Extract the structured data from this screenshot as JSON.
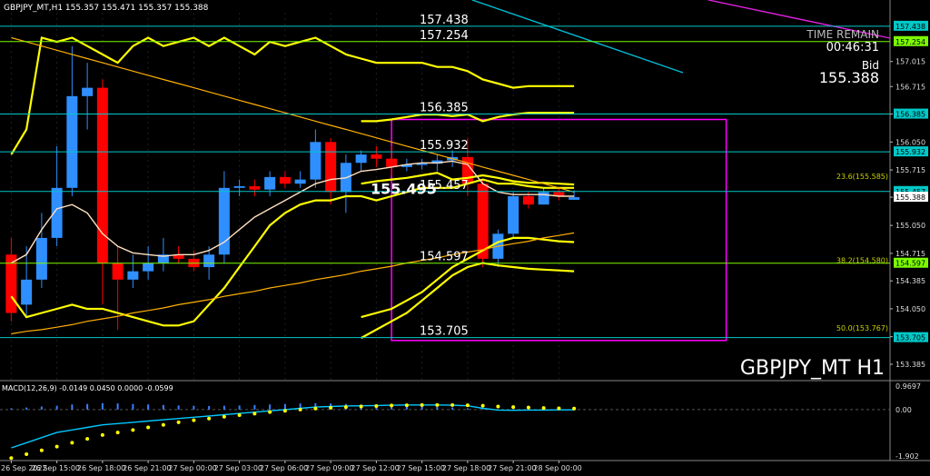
{
  "chart_data": {
    "type": "candlestick",
    "header": "GBPJPY_MT,H1  155.357 155.471 155.357 155.388",
    "symbol_label": "GBPJPY_MT H1",
    "time_remain": {
      "label": "TIME REMAIN",
      "value": "00:46:31"
    },
    "bid": {
      "label": "Bid",
      "value": "155.388"
    },
    "ylim": [
      153.2,
      157.6
    ],
    "x_count": 49,
    "x_ticks": [
      {
        "i": 0,
        "label": "26 Sep 2022"
      },
      {
        "i": 3,
        "label": "26 Sep 15:00"
      },
      {
        "i": 6,
        "label": "26 Sep 18:00"
      },
      {
        "i": 9,
        "label": "26 Sep 21:00"
      },
      {
        "i": 12,
        "label": "27 Sep 00:00"
      },
      {
        "i": 15,
        "label": "27 Sep 03:00"
      },
      {
        "i": 18,
        "label": "27 Sep 06:00"
      },
      {
        "i": 21,
        "label": "27 Sep 09:00"
      },
      {
        "i": 24,
        "label": "27 Sep 12:00"
      },
      {
        "i": 27,
        "label": "27 Sep 15:00"
      },
      {
        "i": 30,
        "label": "27 Sep 18:00"
      },
      {
        "i": 33,
        "label": "27 Sep 21:00"
      },
      {
        "i": 36,
        "label": "28 Sep 00:00"
      }
    ],
    "y_ticks": [
      "157.015",
      "156.715",
      "156.385",
      "156.050",
      "155.715",
      "155.388",
      "155.050",
      "154.715",
      "154.385",
      "154.050",
      "153.715",
      "153.385"
    ],
    "price_tags": [
      {
        "value": 157.438,
        "label": "157.438",
        "color": "#00c8c8"
      },
      {
        "value": 157.254,
        "label": "157.254",
        "color": "#7cfc00"
      },
      {
        "value": 156.385,
        "label": "156.385",
        "color": "#00c8c8"
      },
      {
        "value": 155.932,
        "label": "155.932",
        "color": "#00c8c8"
      },
      {
        "value": 155.457,
        "label": "155.457",
        "color": "#00c8c8"
      },
      {
        "value": 154.597,
        "label": "154.597",
        "color": "#7cfc00"
      },
      {
        "value": 153.705,
        "label": "153.705",
        "color": "#00c8c8"
      }
    ],
    "current_price": {
      "value": 155.388,
      "label": "155.388"
    },
    "hlines": [
      {
        "value": 157.438,
        "label": "157.438",
        "color": "#00c8c8"
      },
      {
        "value": 157.254,
        "label": "157.254",
        "color": "#7cfc00"
      },
      {
        "value": 156.385,
        "label": "156.385",
        "color": "#00c8c8"
      },
      {
        "value": 155.932,
        "label": "155.932",
        "color": "#00c8c8"
      },
      {
        "value": 155.457,
        "label": "155.457",
        "color": "#00c8c8"
      },
      {
        "value": 154.597,
        "label": "154.597",
        "color": "#7cfc00"
      },
      {
        "value": 153.705,
        "label": "153.705",
        "color": "#00c8c8"
      }
    ],
    "fib_labels": [
      {
        "value": 155.585,
        "label": "23.6(155.585)"
      },
      {
        "value": 154.58,
        "label": "38.2(154.580)"
      },
      {
        "value": 153.767,
        "label": "50.0(153.767)"
      }
    ],
    "big_label": {
      "value": 155.495,
      "label": "155.495"
    },
    "box": {
      "i0": 25,
      "i1": 47,
      "y_top": 156.32,
      "y_bottom": 153.67
    },
    "candles": [
      {
        "o": 154.7,
        "h": 154.9,
        "c": 154.0,
        "l": 153.9
      },
      {
        "o": 154.1,
        "h": 154.8,
        "c": 154.4,
        "l": 153.95
      },
      {
        "o": 154.4,
        "h": 155.2,
        "c": 154.9,
        "l": 154.3
      },
      {
        "o": 154.9,
        "h": 156.0,
        "c": 155.5,
        "l": 154.8
      },
      {
        "o": 155.5,
        "h": 157.2,
        "c": 156.6,
        "l": 155.4
      },
      {
        "o": 156.6,
        "h": 157.0,
        "c": 156.7,
        "l": 156.2
      },
      {
        "o": 156.7,
        "h": 156.8,
        "c": 154.6,
        "l": 154.1
      },
      {
        "o": 154.6,
        "h": 154.8,
        "c": 154.4,
        "l": 153.8
      },
      {
        "o": 154.4,
        "h": 154.7,
        "c": 154.5,
        "l": 154.3
      },
      {
        "o": 154.5,
        "h": 154.8,
        "c": 154.6,
        "l": 154.4
      },
      {
        "o": 154.6,
        "h": 154.9,
        "c": 154.7,
        "l": 154.5
      },
      {
        "o": 154.7,
        "h": 154.8,
        "c": 154.65,
        "l": 154.6
      },
      {
        "o": 154.65,
        "h": 154.75,
        "c": 154.55,
        "l": 154.5
      },
      {
        "o": 154.55,
        "h": 154.8,
        "c": 154.7,
        "l": 154.4
      },
      {
        "o": 154.7,
        "h": 155.7,
        "c": 155.5,
        "l": 154.6
      },
      {
        "o": 155.5,
        "h": 155.6,
        "c": 155.52,
        "l": 155.4
      },
      {
        "o": 155.52,
        "h": 155.6,
        "c": 155.48,
        "l": 155.4
      },
      {
        "o": 155.48,
        "h": 155.7,
        "c": 155.63,
        "l": 155.4
      },
      {
        "o": 155.63,
        "h": 155.7,
        "c": 155.55,
        "l": 155.5
      },
      {
        "o": 155.55,
        "h": 155.7,
        "c": 155.6,
        "l": 155.5
      },
      {
        "o": 155.6,
        "h": 156.2,
        "c": 156.05,
        "l": 155.5
      },
      {
        "o": 156.05,
        "h": 156.1,
        "c": 155.45,
        "l": 155.3
      },
      {
        "o": 155.45,
        "h": 155.9,
        "c": 155.8,
        "l": 155.2
      },
      {
        "o": 155.8,
        "h": 155.95,
        "c": 155.9,
        "l": 155.7
      },
      {
        "o": 155.9,
        "h": 156.0,
        "c": 155.85,
        "l": 155.75
      },
      {
        "o": 155.85,
        "h": 156.0,
        "c": 155.75,
        "l": 155.65
      },
      {
        "o": 155.75,
        "h": 155.85,
        "c": 155.78,
        "l": 155.7
      },
      {
        "o": 155.78,
        "h": 155.85,
        "c": 155.79,
        "l": 155.72
      },
      {
        "o": 155.79,
        "h": 155.9,
        "c": 155.83,
        "l": 155.7
      },
      {
        "o": 155.83,
        "h": 155.95,
        "c": 155.87,
        "l": 155.75
      },
      {
        "o": 155.87,
        "h": 156.1,
        "c": 155.55,
        "l": 155.4
      },
      {
        "o": 155.55,
        "h": 155.6,
        "c": 154.65,
        "l": 154.55
      },
      {
        "o": 154.65,
        "h": 155.0,
        "c": 154.95,
        "l": 154.55
      },
      {
        "o": 154.95,
        "h": 155.45,
        "c": 155.4,
        "l": 154.9
      },
      {
        "o": 155.4,
        "h": 155.45,
        "c": 155.3,
        "l": 155.25
      },
      {
        "o": 155.3,
        "h": 155.5,
        "c": 155.45,
        "l": 155.3
      },
      {
        "o": 155.45,
        "h": 155.5,
        "c": 155.4,
        "l": 155.35
      },
      {
        "o": 155.357,
        "h": 155.471,
        "c": 155.388,
        "l": 155.357
      }
    ],
    "lines": [
      {
        "color": "#ffff00",
        "width": 2.2,
        "values": [
          155.9,
          156.2,
          157.3,
          157.25,
          157.3,
          157.2,
          157.1,
          157.0,
          157.2,
          157.3,
          157.2,
          157.25,
          157.3,
          157.2,
          157.3,
          157.2,
          157.1,
          157.25,
          157.2,
          157.25,
          157.3,
          157.2,
          157.1,
          157.05,
          157.0,
          157.0,
          157.0,
          157.0,
          156.95,
          156.95,
          156.9,
          156.8,
          156.75,
          156.7,
          156.72,
          156.72,
          156.72,
          156.72
        ]
      },
      {
        "color": "#ffff00",
        "width": 2.2,
        "values": [
          null,
          null,
          null,
          null,
          null,
          null,
          null,
          null,
          null,
          null,
          null,
          null,
          null,
          null,
          null,
          null,
          null,
          null,
          null,
          null,
          null,
          null,
          null,
          156.3,
          156.3,
          156.32,
          156.35,
          156.38,
          156.38,
          156.36,
          156.38,
          156.3,
          156.35,
          156.38,
          156.4,
          156.4,
          156.4,
          156.4
        ]
      },
      {
        "color": "#ffff00",
        "width": 2.2,
        "values": [
          null,
          null,
          null,
          null,
          null,
          null,
          null,
          null,
          null,
          null,
          null,
          null,
          null,
          null,
          null,
          null,
          null,
          null,
          null,
          null,
          null,
          null,
          null,
          155.55,
          155.58,
          155.6,
          155.62,
          155.65,
          155.68,
          155.6,
          155.62,
          155.65,
          155.62,
          155.58,
          155.56,
          155.56,
          155.55,
          155.54
        ]
      },
      {
        "color": "#ffff00",
        "width": 2.2,
        "values": [
          154.2,
          153.95,
          154.0,
          154.05,
          154.1,
          154.05,
          154.05,
          154.0,
          153.95,
          153.9,
          153.85,
          153.85,
          153.9,
          154.1,
          154.3,
          154.55,
          154.8,
          155.05,
          155.2,
          155.3,
          155.35,
          155.35,
          155.4,
          155.4,
          155.35,
          155.4,
          155.45,
          155.5,
          155.5,
          155.5,
          155.55,
          155.6,
          155.55,
          155.55,
          155.52,
          155.5,
          155.5,
          155.5
        ]
      },
      {
        "color": "#ffff00",
        "width": 2.2,
        "values": [
          null,
          null,
          null,
          null,
          null,
          null,
          null,
          null,
          null,
          null,
          null,
          null,
          null,
          null,
          null,
          null,
          null,
          null,
          null,
          null,
          null,
          null,
          null,
          153.95,
          154.0,
          154.05,
          154.15,
          154.25,
          154.4,
          154.55,
          154.65,
          154.75,
          154.85,
          154.9,
          154.9,
          154.88,
          154.86,
          154.85
        ]
      },
      {
        "color": "#ffff00",
        "width": 2.2,
        "values": [
          null,
          null,
          null,
          null,
          null,
          null,
          null,
          null,
          null,
          null,
          null,
          null,
          null,
          null,
          null,
          null,
          null,
          null,
          null,
          null,
          null,
          null,
          null,
          153.7,
          153.8,
          153.9,
          154.0,
          154.15,
          154.3,
          154.45,
          154.55,
          154.6,
          154.57,
          154.55,
          154.53,
          154.52,
          154.51,
          154.5
        ]
      },
      {
        "color": "#ffe0c0",
        "width": 1.4,
        "values": [
          154.6,
          154.7,
          155.0,
          155.25,
          155.3,
          155.2,
          154.95,
          154.8,
          154.72,
          154.7,
          154.68,
          154.7,
          154.7,
          154.75,
          154.85,
          155.0,
          155.15,
          155.25,
          155.35,
          155.45,
          155.55,
          155.6,
          155.62,
          155.7,
          155.72,
          155.75,
          155.78,
          155.8,
          155.8,
          155.82,
          155.78,
          155.55,
          155.45,
          155.42,
          155.42,
          155.42,
          155.4,
          155.4
        ]
      },
      {
        "color": "#ffb000",
        "width": 1.2,
        "values": [
          157.3,
          157.25,
          157.2,
          157.15,
          157.1,
          157.05,
          157.0,
          156.95,
          156.9,
          156.85,
          156.8,
          156.75,
          156.7,
          156.65,
          156.6,
          156.55,
          156.5,
          156.45,
          156.4,
          156.35,
          156.3,
          156.25,
          156.2,
          156.15,
          156.1,
          156.05,
          156.0,
          155.95,
          155.9,
          155.85,
          155.8,
          155.75,
          155.7,
          155.65,
          155.6,
          155.55,
          155.5,
          155.45
        ]
      },
      {
        "color": "#ffb000",
        "width": 1.2,
        "values": [
          153.75,
          153.78,
          153.8,
          153.83,
          153.86,
          153.9,
          153.93,
          153.96,
          154.0,
          154.03,
          154.06,
          154.1,
          154.13,
          154.16,
          154.2,
          154.23,
          154.26,
          154.3,
          154.33,
          154.36,
          154.4,
          154.43,
          154.46,
          154.5,
          154.53,
          154.56,
          154.6,
          154.63,
          154.66,
          154.7,
          154.73,
          154.76,
          154.8,
          154.83,
          154.86,
          154.9,
          154.93,
          154.96
        ]
      }
    ],
    "macd": {
      "label": "MACD(12,26,9) -0.0149 0.0450 0.0000 -0.0599",
      "ylim": [
        -2.0,
        1.1
      ],
      "y_ticks": [
        "0.9697",
        "0.00",
        "-1.902"
      ],
      "histogram": [
        0.05,
        0.08,
        0.12,
        0.15,
        0.2,
        0.22,
        0.25,
        0.24,
        0.22,
        0.2,
        0.18,
        0.16,
        0.15,
        0.14,
        0.15,
        0.16,
        0.18,
        0.2,
        0.22,
        0.24,
        0.25,
        0.24,
        0.22,
        0.2,
        0.18,
        0.16,
        0.14,
        0.12,
        0.1,
        0.08,
        0.05,
        0.02,
        0.0,
        -0.01,
        -0.01,
        -0.01,
        -0.01,
        -0.01
      ],
      "macd_line": [
        -1.5,
        -1.3,
        -1.1,
        -0.9,
        -0.8,
        -0.7,
        -0.6,
        -0.55,
        -0.5,
        -0.45,
        -0.4,
        -0.35,
        -0.3,
        -0.25,
        -0.2,
        -0.15,
        -0.1,
        -0.05,
        0.0,
        0.05,
        0.1,
        0.12,
        0.14,
        0.15,
        0.16,
        0.17,
        0.18,
        0.18,
        0.18,
        0.17,
        0.15,
        0.05,
        -0.02,
        -0.03,
        -0.02,
        -0.02,
        -0.01,
        -0.01
      ],
      "signal": [
        -1.9,
        -1.75,
        -1.6,
        -1.45,
        -1.3,
        -1.15,
        -1.0,
        -0.9,
        -0.8,
        -0.7,
        -0.6,
        -0.5,
        -0.42,
        -0.35,
        -0.28,
        -0.22,
        -0.16,
        -0.1,
        -0.05,
        0.0,
        0.04,
        0.07,
        0.1,
        0.12,
        0.14,
        0.16,
        0.17,
        0.18,
        0.18,
        0.18,
        0.17,
        0.15,
        0.12,
        0.1,
        0.08,
        0.06,
        0.05,
        0.04
      ]
    }
  }
}
